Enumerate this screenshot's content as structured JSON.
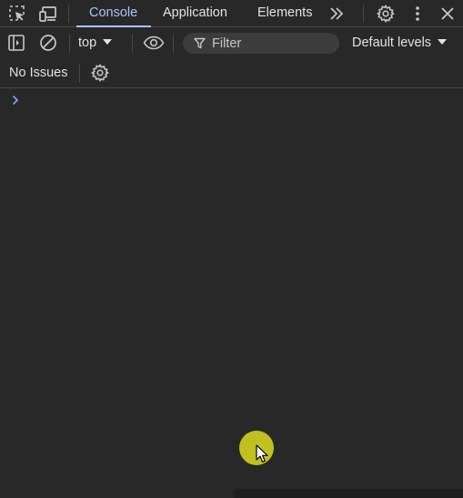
{
  "tabs": [
    {
      "label": "Console",
      "active": true
    },
    {
      "label": "Application",
      "active": false
    },
    {
      "label": "Elements",
      "active": false
    }
  ],
  "toolbar": {
    "context": "top",
    "filter_placeholder": "Filter",
    "levels": "Default levels"
  },
  "issues": {
    "label": "No Issues"
  },
  "icons": {
    "inspect": "inspect-element-icon",
    "device": "device-toolbar-icon",
    "more_tabs": "chevron-double-right-icon",
    "settings": "gear-icon",
    "kebab": "kebab-menu-icon",
    "close": "close-icon",
    "sidebar": "sidebar-toggle-icon",
    "clear": "clear-console-icon",
    "eye": "eye-icon",
    "filter": "filter-icon",
    "issues_settings": "gear-icon",
    "prompt": "chevron-right-icon"
  },
  "colors": {
    "background": "#282828",
    "accent": "#a8c7fa",
    "text": "#e3e3e3",
    "cursor_highlight": "#c8c81e"
  }
}
